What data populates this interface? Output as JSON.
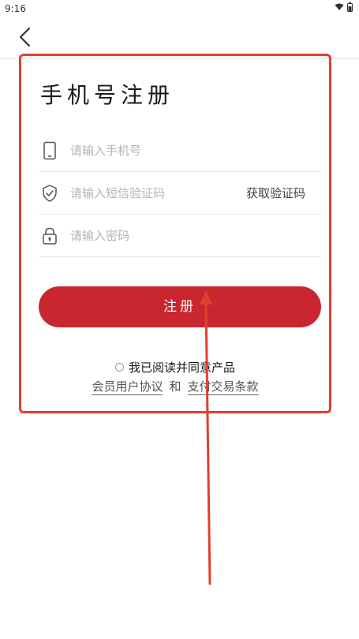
{
  "status_bar": {
    "time": "9:16"
  },
  "form": {
    "title": "手机号注册",
    "phone_placeholder": "请输入手机号",
    "code_placeholder": "请输入短信验证码",
    "get_code_label": "获取验证码",
    "password_placeholder": "请输入密码",
    "submit_label": "注册"
  },
  "agreement": {
    "text": "我已阅读并同意产品",
    "member_agreement": "会员用户协议",
    "and": "和",
    "payment_terms": "支付交易条款"
  },
  "colors": {
    "accent": "#c9262f",
    "annotation": "#e0402f"
  },
  "icons": [
    "phone-icon",
    "shield-check-icon",
    "lock-icon",
    "back-icon",
    "wifi-icon",
    "battery-icon"
  ]
}
